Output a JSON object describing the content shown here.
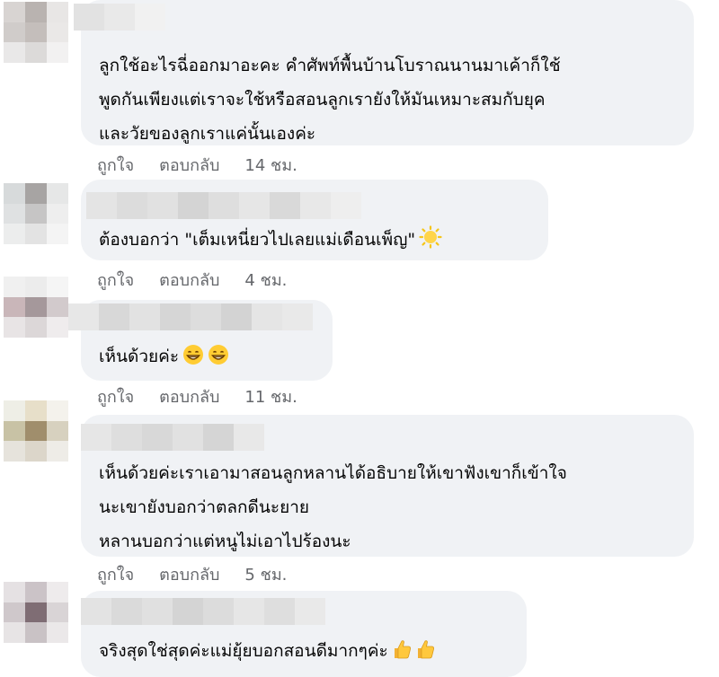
{
  "actions": {
    "like": "ถูกใจ",
    "reply": "ตอบกลับ"
  },
  "comments": [
    {
      "lines": [
        "ลูกใช้อะไรฉี่ออกมาอะคะ คำศัพท์พื้นบ้านโบราณนานมาเค้าก็ใช้",
        "พูดกันเพียงแต่เราจะใช้หรือสอนลูกเรายังให้มันเหมาะสมกับยุค",
        "และวัยของลูกเราแค่นั้นเองค่ะ"
      ],
      "time": "14 ชม."
    },
    {
      "lines": [
        "ต้องบอกว่า \"เต็มเหนี่ยวไปเลยแม่เดือนเพ็ญ\""
      ],
      "emoji": [
        "sun-emoji"
      ],
      "time": "4 ชม."
    },
    {
      "lines": [
        "เห็นด้วยค่ะ"
      ],
      "emoji": [
        "grin-emoji",
        "grin-emoji"
      ],
      "time": "11 ชม."
    },
    {
      "lines": [
        "เห็นด้วยค่ะเราเอามาสอนลูกหลานได้อธิบายให้เขาฟังเขาก็เข้าใจ",
        "นะเขายังบอกว่าตลกดีนะยาย",
        "หลานบอกว่าแต่หนูไม่เอาไปร้องนะ"
      ],
      "time": "5 ชม."
    },
    {
      "lines": [
        "จริงสุดใช่สุดค่ะแม่ยุ้ยบอกสอนดีมากๆค่ะ"
      ],
      "emoji": [
        "thumbs-up-emoji",
        "thumbs-up-emoji"
      ]
    }
  ]
}
